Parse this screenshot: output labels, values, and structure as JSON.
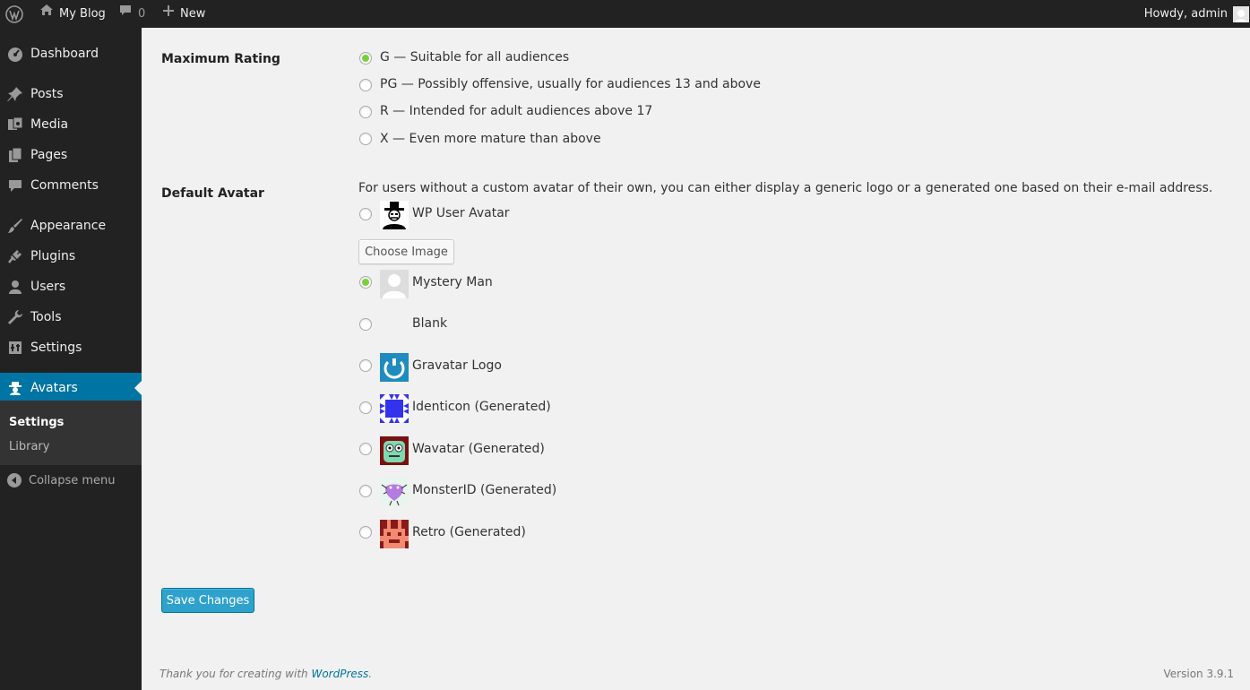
{
  "adminbar": {
    "site_name": "My Blog",
    "comments_count": "0",
    "new_label": "New",
    "howdy": "Howdy, admin"
  },
  "sidebar": {
    "items": [
      {
        "label": "Dashboard",
        "icon": "dashboard-icon"
      },
      {
        "label": "Posts",
        "icon": "pin-icon"
      },
      {
        "label": "Media",
        "icon": "media-icon"
      },
      {
        "label": "Pages",
        "icon": "pages-icon"
      },
      {
        "label": "Comments",
        "icon": "comment-icon"
      },
      {
        "label": "Appearance",
        "icon": "brush-icon"
      },
      {
        "label": "Plugins",
        "icon": "plug-icon"
      },
      {
        "label": "Users",
        "icon": "user-icon"
      },
      {
        "label": "Tools",
        "icon": "wrench-icon"
      },
      {
        "label": "Settings",
        "icon": "settings-icon"
      },
      {
        "label": "Avatars",
        "icon": "avatar-icon"
      }
    ],
    "submenu": [
      "Settings",
      "Library"
    ],
    "collapse": "Collapse menu"
  },
  "rating": {
    "label": "Maximum Rating",
    "options": [
      "G — Suitable for all audiences",
      "PG — Possibly offensive, usually for audiences 13 and above",
      "R — Intended for adult audiences above 17",
      "X — Even more mature than above"
    ],
    "selected": 0
  },
  "avatar": {
    "label": "Default Avatar",
    "description": "For users without a custom avatar of their own, you can either display a generic logo or a generated one based on their e-mail address.",
    "choose_button": "Choose Image",
    "options": [
      "WP User Avatar",
      "Mystery Man",
      "Blank",
      "Gravatar Logo",
      "Identicon (Generated)",
      "Wavatar (Generated)",
      "MonsterID (Generated)",
      "Retro (Generated)"
    ],
    "selected": 1
  },
  "save_button": "Save Changes",
  "footer": {
    "thanks_prefix": "Thank you for creating with ",
    "thanks_link": "WordPress",
    "thanks_suffix": ".",
    "version": "Version 3.9.1"
  },
  "colors": {
    "adminbar_bg": "#222222",
    "sidebar_current": "#0074a2",
    "primary_button": "#2ea2cc",
    "radio_checked": "#7ad03a"
  }
}
